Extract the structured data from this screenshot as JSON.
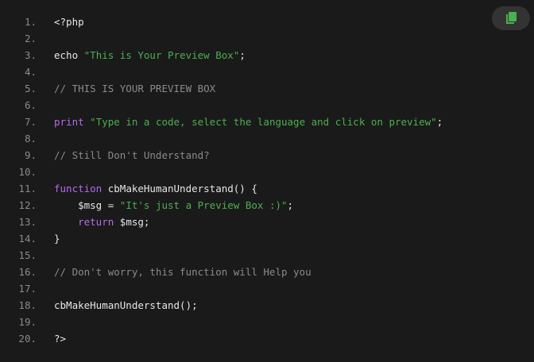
{
  "colors": {
    "background": "#1a1a1a",
    "line_number": "#8a8a8a",
    "plain": "#e6e6e6",
    "string": "#4caf50",
    "comment": "#8a8a8a",
    "keyword": "#b26cf0",
    "copy_button_bg": "#333333",
    "copy_icon": "#4caf50"
  },
  "toolbar": {
    "copy_icon": "copy-icon"
  },
  "lines": [
    {
      "num": "1.",
      "tokens": [
        {
          "t": "plain",
          "v": "<?php"
        }
      ]
    },
    {
      "num": "2.",
      "tokens": []
    },
    {
      "num": "3.",
      "tokens": [
        {
          "t": "plain",
          "v": "echo "
        },
        {
          "t": "string",
          "v": "\"This is Your Preview Box\""
        },
        {
          "t": "plain",
          "v": ";"
        }
      ]
    },
    {
      "num": "4.",
      "tokens": []
    },
    {
      "num": "5.",
      "tokens": [
        {
          "t": "comment",
          "v": "// THIS IS YOUR PREVIEW BOX"
        }
      ]
    },
    {
      "num": "6.",
      "tokens": []
    },
    {
      "num": "7.",
      "tokens": [
        {
          "t": "keyword",
          "v": "print"
        },
        {
          "t": "plain",
          "v": " "
        },
        {
          "t": "string",
          "v": "\"Type in a code, select the language and click on preview\""
        },
        {
          "t": "plain",
          "v": ";"
        }
      ]
    },
    {
      "num": "8.",
      "tokens": []
    },
    {
      "num": "9.",
      "tokens": [
        {
          "t": "comment",
          "v": "// Still Don't Understand?"
        }
      ]
    },
    {
      "num": "10.",
      "tokens": []
    },
    {
      "num": "11.",
      "tokens": [
        {
          "t": "keyword",
          "v": "function"
        },
        {
          "t": "plain",
          "v": " cbMakeHumanUnderstand() {"
        }
      ]
    },
    {
      "num": "12.",
      "tokens": [
        {
          "t": "plain",
          "v": "    $msg = "
        },
        {
          "t": "string",
          "v": "\"It's just a Preview Box :)\""
        },
        {
          "t": "plain",
          "v": ";"
        }
      ]
    },
    {
      "num": "13.",
      "tokens": [
        {
          "t": "plain",
          "v": "    "
        },
        {
          "t": "keyword",
          "v": "return"
        },
        {
          "t": "plain",
          "v": " $msg;"
        }
      ]
    },
    {
      "num": "14.",
      "tokens": [
        {
          "t": "plain",
          "v": "}"
        }
      ]
    },
    {
      "num": "15.",
      "tokens": []
    },
    {
      "num": "16.",
      "tokens": [
        {
          "t": "comment",
          "v": "// Don't worry, this function will Help you"
        }
      ]
    },
    {
      "num": "17.",
      "tokens": []
    },
    {
      "num": "18.",
      "tokens": [
        {
          "t": "plain",
          "v": "cbMakeHumanUnderstand();"
        }
      ]
    },
    {
      "num": "19.",
      "tokens": []
    },
    {
      "num": "20.",
      "tokens": [
        {
          "t": "plain",
          "v": "?>"
        }
      ]
    }
  ]
}
